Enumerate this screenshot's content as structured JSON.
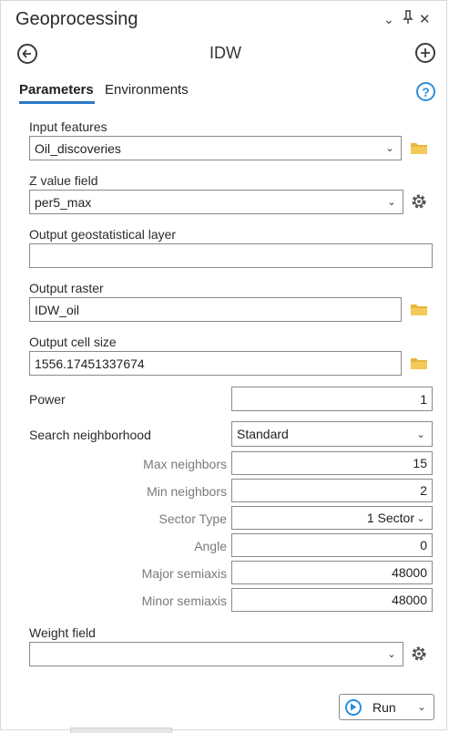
{
  "header": {
    "title": "Geoprocessing",
    "menu_glyph": "⌄",
    "pin_glyph": "⊥",
    "close_glyph": "✕"
  },
  "tool": {
    "title": "IDW",
    "back_icon": "back-arrow-icon",
    "add_icon": "plus-icon"
  },
  "tabs": [
    {
      "label": "Parameters",
      "active": true
    },
    {
      "label": "Environments",
      "active": false
    }
  ],
  "help_glyph": "?",
  "params": {
    "input_features": {
      "label": "Input features",
      "value": "Oil_discoveries"
    },
    "z_value_field": {
      "label": "Z value field",
      "value": "per5_max"
    },
    "output_geostat": {
      "label": "Output geostatistical layer",
      "value": ""
    },
    "output_raster": {
      "label": "Output raster",
      "value": "IDW_oil"
    },
    "output_cell_size": {
      "label": "Output cell size",
      "value": "1556.17451337674"
    },
    "power": {
      "label": "Power",
      "value": "1"
    },
    "search_neighborhood": {
      "label": "Search neighborhood",
      "value": "Standard"
    },
    "max_neighbors": {
      "label": "Max neighbors",
      "value": "15"
    },
    "min_neighbors": {
      "label": "Min neighbors",
      "value": "2"
    },
    "sector_type": {
      "label": "Sector Type",
      "value": "1 Sector"
    },
    "angle": {
      "label": "Angle",
      "value": "0"
    },
    "major_semiaxis": {
      "label": "Major semiaxis",
      "value": "48000"
    },
    "minor_semiaxis": {
      "label": "Minor semiaxis",
      "value": "48000"
    },
    "weight_field": {
      "label": "Weight field",
      "value": ""
    }
  },
  "run": {
    "label": "Run"
  },
  "colors": {
    "accent": "#2a8fdc",
    "folder": "#e8b53c",
    "tab_underline": "#2a78c6"
  }
}
